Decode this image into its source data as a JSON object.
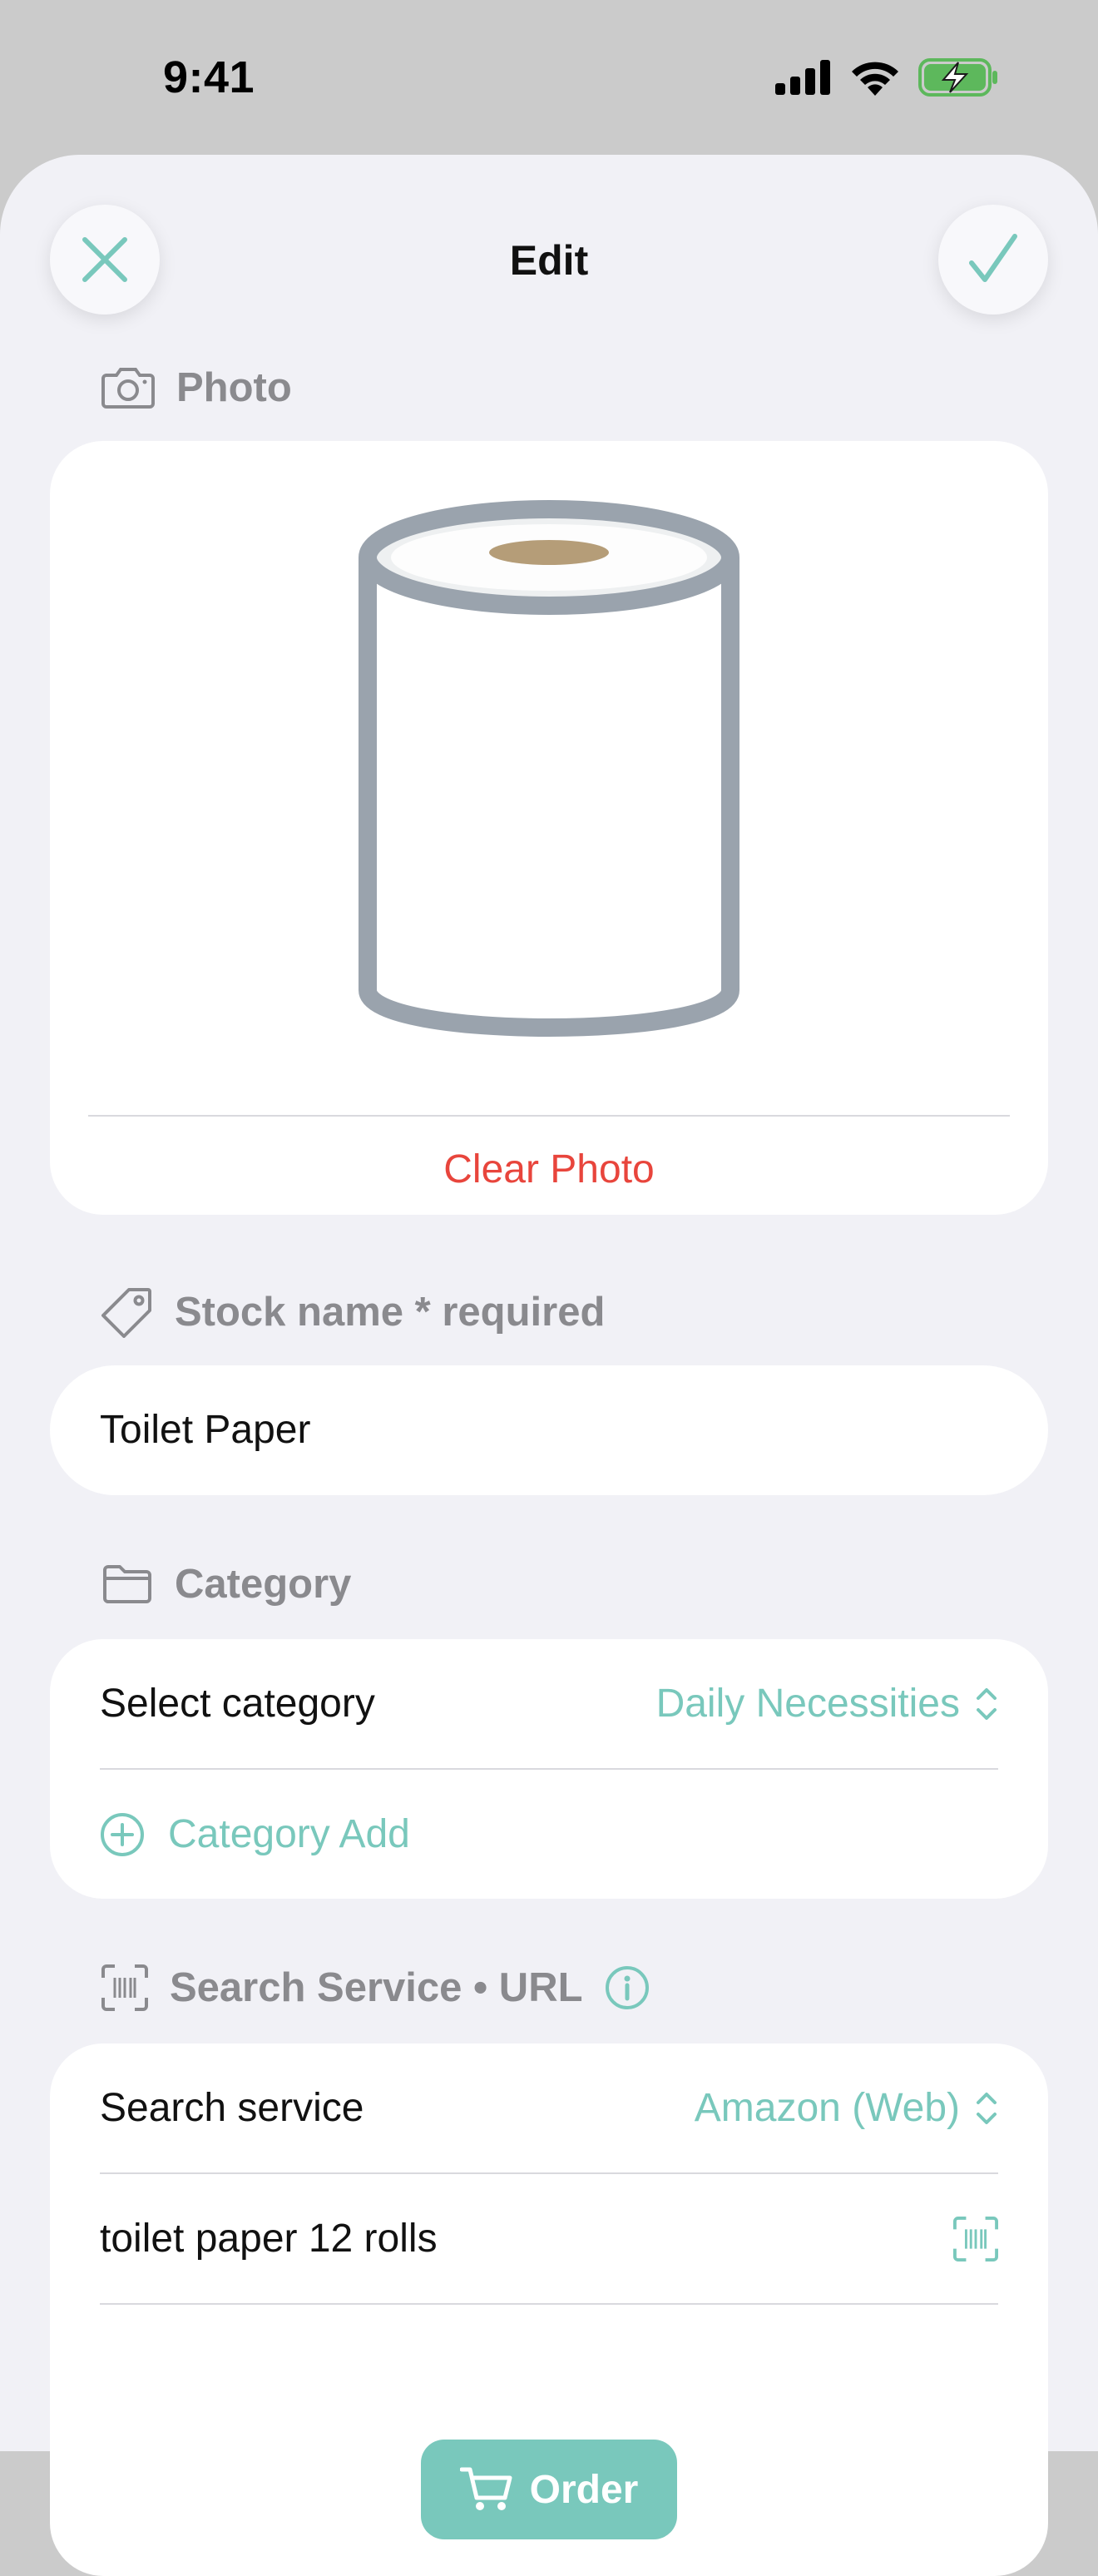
{
  "status": {
    "time": "9:41"
  },
  "header": {
    "title": "Edit"
  },
  "photo": {
    "section_label": "Photo",
    "clear_label": "Clear Photo"
  },
  "stock": {
    "section_label": "Stock name * required",
    "name_value": "Toilet Paper"
  },
  "category": {
    "section_label": "Category",
    "select_label": "Select category",
    "selected_value": "Daily Necessities",
    "add_label": "Category Add"
  },
  "search": {
    "section_label": "Search Service • URL",
    "service_label": "Search service",
    "service_value": "Amazon (Web)",
    "query_value": "toilet paper 12 rolls",
    "order_label": "Order"
  },
  "colors": {
    "accent": "#79c8bc",
    "destructive": "#e8453c",
    "background": "#f1f1f6"
  }
}
